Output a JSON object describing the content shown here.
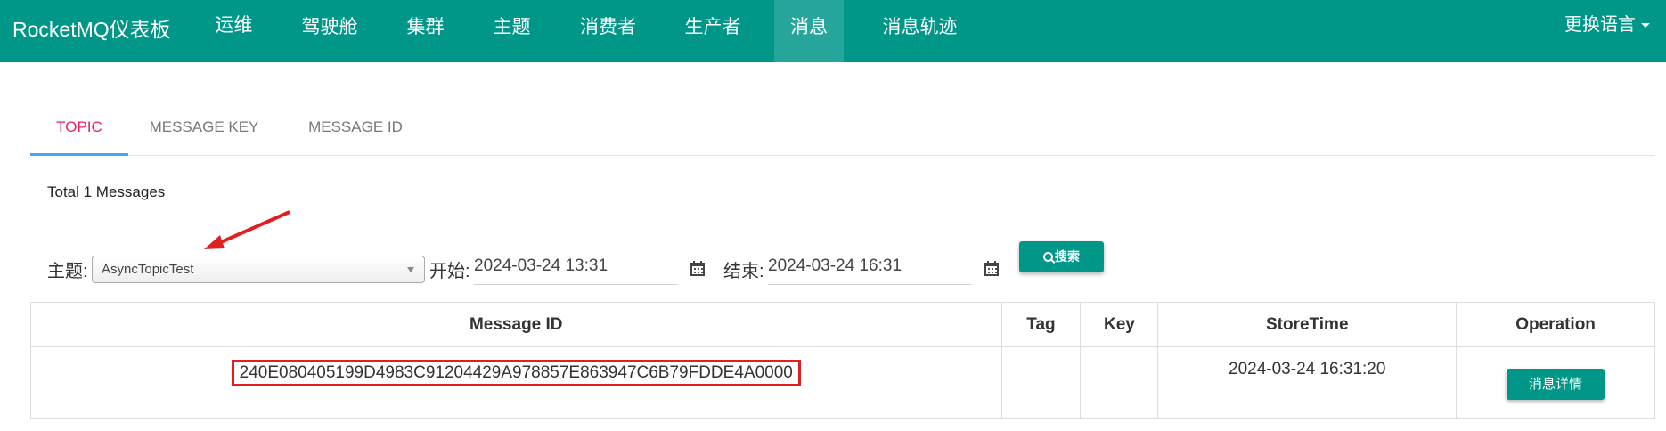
{
  "navbar": {
    "brand": "RocketMQ仪表板",
    "items": [
      "运维",
      "驾驶舱",
      "集群",
      "主题",
      "消费者",
      "生产者",
      "消息",
      "消息轨迹"
    ],
    "active_item": "消息",
    "language": "更换语言"
  },
  "tabs": [
    "TOPIC",
    "MESSAGE KEY",
    "MESSAGE ID"
  ],
  "active_tab": "TOPIC",
  "total_text": "Total 1 Messages",
  "search": {
    "topic_label": "主题:",
    "topic_value": "AsyncTopicTest",
    "begin_label": "开始:",
    "begin_value": "2024-03-24 13:31",
    "end_label": "结束:",
    "end_value": "2024-03-24 16:31",
    "button_label": "搜索"
  },
  "table": {
    "headers": [
      "Message ID",
      "Tag",
      "Key",
      "StoreTime",
      "Operation"
    ],
    "rows": [
      {
        "message_id": "240E080405199D4983C91204429A978857E863947C6B79FDDE4A0000",
        "tag": "",
        "key": "",
        "store_time": "2024-03-24 16:31:20",
        "operation": "消息详情"
      }
    ]
  },
  "colors": {
    "primary": "#009688",
    "active_nav": "#26a69a",
    "active_tab_text": "#e91e63",
    "active_tab_underline": "#42a5f5",
    "highlight_box": "#e02020"
  }
}
